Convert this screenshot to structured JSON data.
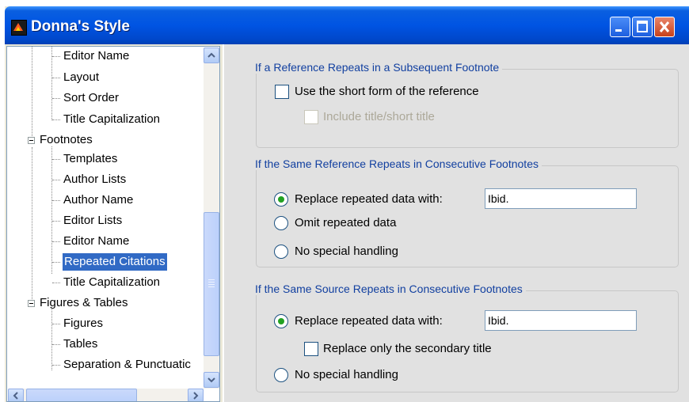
{
  "window": {
    "title": "Donna's Style"
  },
  "tree": {
    "items": [
      {
        "label": "Editor Name"
      },
      {
        "label": "Layout"
      },
      {
        "label": "Sort Order"
      },
      {
        "label": "Title Capitalization"
      },
      {
        "label": "Footnotes"
      },
      {
        "label": "Templates"
      },
      {
        "label": "Author Lists"
      },
      {
        "label": "Author Name"
      },
      {
        "label": "Editor Lists"
      },
      {
        "label": "Editor Name"
      },
      {
        "label": "Repeated Citations"
      },
      {
        "label": "Title Capitalization"
      },
      {
        "label": "Figures & Tables"
      },
      {
        "label": "Figures"
      },
      {
        "label": "Tables"
      },
      {
        "label": "Separation & Punctuatic"
      }
    ],
    "selected": "Repeated Citations",
    "expanded": [
      "Footnotes",
      "Figures & Tables"
    ]
  },
  "panel": {
    "group1": {
      "title": "If a Reference Repeats in a Subsequent Footnote",
      "short_form_label": "Use the short form of the reference",
      "short_form_checked": false,
      "include_title_label": "Include title/short title",
      "include_title_enabled": false
    },
    "group2": {
      "title": "If the Same Reference Repeats in Consecutive Footnotes",
      "options": [
        {
          "label": "Replace repeated data with:",
          "selected": true
        },
        {
          "label": "Omit repeated data",
          "selected": false
        },
        {
          "label": "No special handling",
          "selected": false
        }
      ],
      "replace_value": "Ibid."
    },
    "group3": {
      "title": "If the Same Source Repeats in Consecutive Footnotes",
      "options": [
        {
          "label": "Replace repeated data with:",
          "selected": true
        },
        {
          "label": "No special handling",
          "selected": false
        }
      ],
      "replace_value": "Ibid.",
      "secondary_title_label": "Replace only the secondary title",
      "secondary_title_checked": false
    }
  },
  "icons": {
    "app": "endnote-style-icon",
    "minimize": "minimize-icon",
    "maximize": "maximize-icon",
    "close": "close-icon"
  },
  "colors": {
    "selection": "#316ac5",
    "radio_dot": "#21a121",
    "group_title": "#1240a0"
  }
}
